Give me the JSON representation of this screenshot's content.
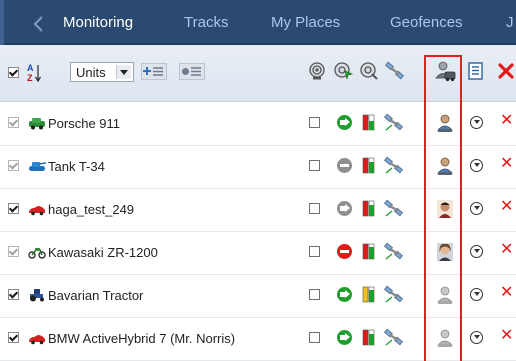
{
  "nav": {
    "tabs": [
      "Monitoring",
      "Tracks",
      "My Places",
      "Geofences",
      "J"
    ],
    "active_tab": "Monitoring"
  },
  "toolbar": {
    "sort_icon": "sort-az-icon",
    "units_select": {
      "selected": "Units",
      "options_visible": [
        "Units"
      ]
    },
    "header_icons": [
      "watch-target-icon",
      "follow-target-icon",
      "command-target-icon",
      "satellite-icon",
      "driver-icon",
      "report-icon",
      "delete-all-icon"
    ]
  },
  "units": [
    {
      "name": "Porsche 911",
      "checked": true,
      "checkbox_enabled": false,
      "vehicle_icon": "green-car-icon",
      "status": "moving",
      "driver": "default"
    },
    {
      "name": "Tank T-34",
      "checked": true,
      "checkbox_enabled": false,
      "vehicle_icon": "blue-tank-icon",
      "status": "stopped",
      "driver": "default"
    },
    {
      "name": "haga_test_249",
      "checked": true,
      "checkbox_enabled": true,
      "vehicle_icon": "red-car-icon",
      "status": "idle",
      "driver": "photo-man"
    },
    {
      "name": "Kawasaki ZR-1200",
      "checked": true,
      "checkbox_enabled": false,
      "vehicle_icon": "motorbike-icon",
      "status": "alarm",
      "driver": "photo-woman"
    },
    {
      "name": "Bavarian Tractor",
      "checked": true,
      "checkbox_enabled": true,
      "vehicle_icon": "tractor-icon",
      "status": "moving",
      "driver": "default-gray"
    },
    {
      "name": "BMW ActiveHybrid 7 (Mr. Norris)",
      "checked": true,
      "checkbox_enabled": true,
      "vehicle_icon": "red-car-icon",
      "status": "moving",
      "driver": "default-gray"
    }
  ],
  "colors": {
    "nav_bg": "#2b4a72",
    "nav_active": "#ffffff",
    "nav_inactive": "#a9c8ea",
    "highlight": "#e02020",
    "delete": "#e01919",
    "status_green": "#1f9e2c",
    "status_red": "#e01919",
    "status_gray": "#8f8f8f"
  }
}
